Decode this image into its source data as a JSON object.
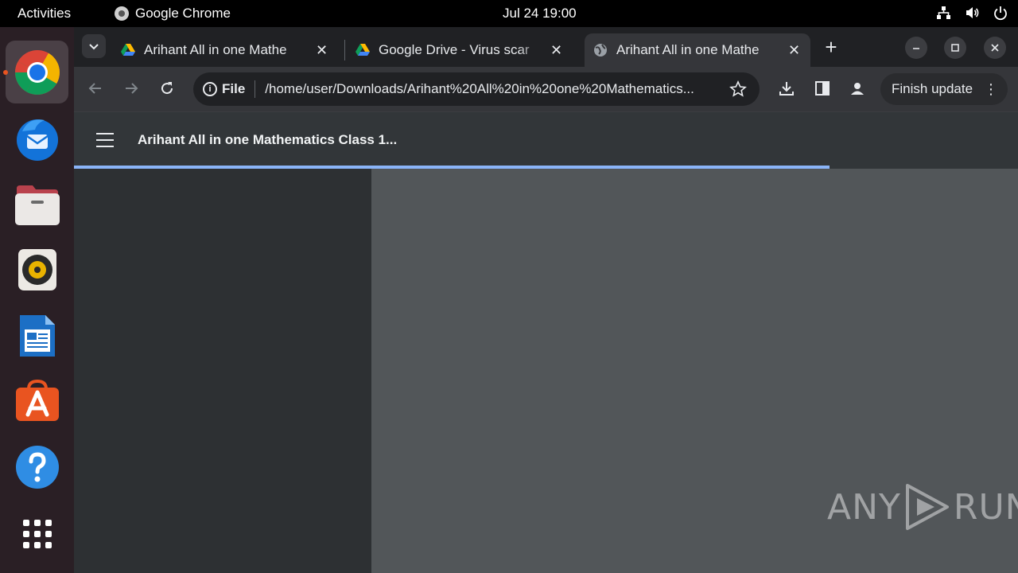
{
  "topbar": {
    "activities": "Activities",
    "app_name": "Google Chrome",
    "clock": "Jul 24  19:00",
    "tray_icons": [
      "network-icon",
      "volume-icon",
      "power-icon"
    ]
  },
  "dock": {
    "items": [
      "chrome-icon",
      "thunderbird-icon",
      "files-icon",
      "rhythmbox-icon",
      "writer-icon",
      "app-center-icon",
      "help-icon",
      "show-apps-icon"
    ]
  },
  "browser": {
    "tabs": [
      {
        "title": "Arihant All in one Mathe",
        "icon": "google-drive-icon"
      },
      {
        "title": "Google Drive - Virus scar",
        "icon": "google-drive-icon"
      },
      {
        "title": "Arihant All in one Mathe",
        "icon": "globe-icon",
        "active": true
      }
    ],
    "omnibox": {
      "scheme": "File",
      "url": "/home/user/Downloads/Arihant%20All%20in%20one%20Mathematics..."
    },
    "finish_update": "Finish update"
  },
  "pdf": {
    "title": "Arihant All in one Mathematics Class 1...",
    "load_progress": 0.8
  },
  "watermark": {
    "left": "ANY",
    "right": "RUN"
  },
  "colors": {
    "accent": "#8ab4f8",
    "dock_running": "#e95420"
  }
}
